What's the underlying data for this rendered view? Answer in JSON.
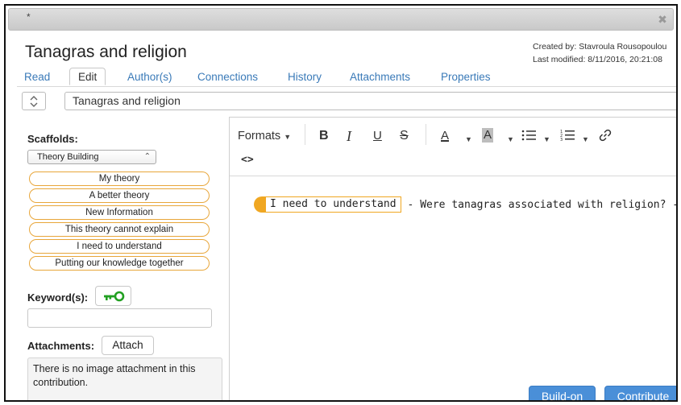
{
  "window": {
    "marker": "*",
    "close_glyph": "✖"
  },
  "note": {
    "title": "Tanagras and religion",
    "created_by": "Created by: Stavroula Rousopoulou",
    "last_modified": "Last modified: 8/11/2016, 20:21:08"
  },
  "tabs": [
    {
      "label": "Read"
    },
    {
      "label": "Edit"
    },
    {
      "label": "Author(s)"
    },
    {
      "label": "Connections"
    },
    {
      "label": "History"
    },
    {
      "label": "Attachments"
    },
    {
      "label": "Properties"
    }
  ],
  "title_field": {
    "value": "Tanagras and religion"
  },
  "scaffolds": {
    "label": "Scaffolds:",
    "selected": "Theory Building",
    "items": [
      "My theory",
      "A better theory",
      "New Information",
      "This theory cannot explain",
      "I need to understand",
      "Putting our knowledge together"
    ]
  },
  "keywords": {
    "label": "Keyword(s):",
    "icon": "key-icon",
    "value": ""
  },
  "attachments": {
    "label": "Attachments:",
    "button": "Attach",
    "info": "There is no image attachment in this contribution."
  },
  "toolbar": {
    "formats": "Formats",
    "bold": "B",
    "italic": "I",
    "underline": "U",
    "strike": "S",
    "font_color": "A",
    "bg_color": "A",
    "code": "<>"
  },
  "editor": {
    "scaffold_tag": "I need to understand",
    "sentence": "- Were tanagras associated with religion? -"
  },
  "actions": {
    "build_on": "Build-on",
    "contribute": "Contribute"
  },
  "colors": {
    "accent": "#3a7ab8",
    "scaffold": "#f0a722",
    "button": "#4a8fd8",
    "key": "#22a022"
  }
}
